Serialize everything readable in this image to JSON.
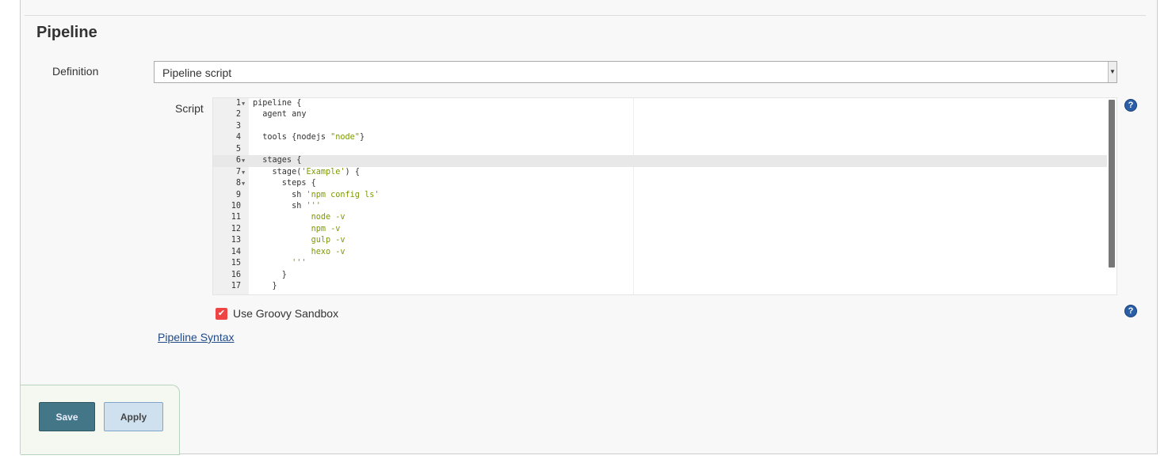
{
  "section_title": "Pipeline",
  "definition": {
    "label": "Definition",
    "value": "Pipeline script"
  },
  "script": {
    "label": "Script",
    "lines": [
      {
        "n": "1",
        "fold": true,
        "parts": [
          [
            "pipeline {",
            ""
          ]
        ]
      },
      {
        "n": "2",
        "parts": [
          [
            "  agent any",
            ""
          ]
        ]
      },
      {
        "n": "3",
        "parts": [
          [
            "",
            ""
          ]
        ]
      },
      {
        "n": "4",
        "parts": [
          [
            "  tools {nodejs ",
            ""
          ],
          [
            "\"node\"",
            "s"
          ],
          [
            "}",
            ""
          ]
        ]
      },
      {
        "n": "5",
        "parts": [
          [
            "",
            ""
          ]
        ]
      },
      {
        "n": "6",
        "fold": true,
        "active": true,
        "parts": [
          [
            "  stages {",
            ""
          ]
        ]
      },
      {
        "n": "7",
        "fold": true,
        "parts": [
          [
            "    stage(",
            ""
          ],
          [
            "'Example'",
            "s"
          ],
          [
            ") {",
            ""
          ]
        ]
      },
      {
        "n": "8",
        "fold": true,
        "parts": [
          [
            "      steps {",
            ""
          ]
        ]
      },
      {
        "n": "9",
        "parts": [
          [
            "        sh ",
            ""
          ],
          [
            "'npm config ls'",
            "s"
          ]
        ]
      },
      {
        "n": "10",
        "parts": [
          [
            "        sh ",
            ""
          ],
          [
            "'''",
            "s"
          ]
        ]
      },
      {
        "n": "11",
        "parts": [
          [
            "            node -v",
            "s"
          ]
        ]
      },
      {
        "n": "12",
        "parts": [
          [
            "            npm -v",
            "s"
          ]
        ]
      },
      {
        "n": "13",
        "parts": [
          [
            "            gulp -v",
            "s"
          ]
        ]
      },
      {
        "n": "14",
        "parts": [
          [
            "            hexo -v",
            "s"
          ]
        ]
      },
      {
        "n": "15",
        "parts": [
          [
            "        '''",
            "s"
          ]
        ]
      },
      {
        "n": "16",
        "parts": [
          [
            "      }",
            ""
          ]
        ]
      },
      {
        "n": "17",
        "parts": [
          [
            "    }",
            ""
          ]
        ]
      }
    ]
  },
  "sandbox": {
    "label": "Use Groovy Sandbox",
    "checked": true
  },
  "syntax_link": "Pipeline Syntax",
  "buttons": {
    "save": "Save",
    "apply": "Apply"
  },
  "help_icon": "?"
}
